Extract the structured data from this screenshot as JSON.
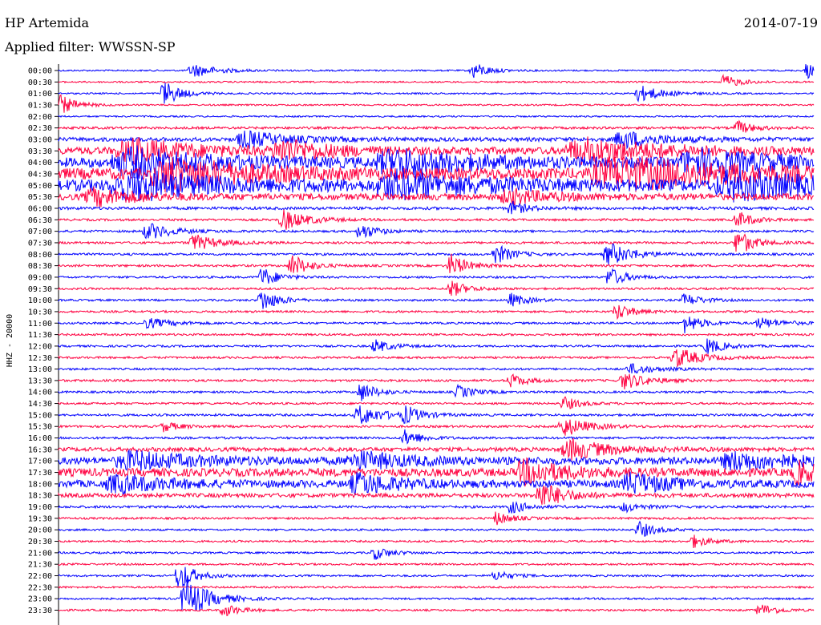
{
  "header": {
    "station": "HP Artemida",
    "filter": "Applied filter: WWSSN-SP",
    "date": "2014-07-19"
  },
  "chart_data": {
    "type": "helicorder",
    "title": "HP Artemida",
    "subtitle": "Applied filter: WWSSN-SP",
    "date": "2014-07-19",
    "ylabel": "HHZ - 20000",
    "x_minutes_per_line": 30,
    "colors": {
      "a": "#0000ff",
      "b": "#ff0040"
    },
    "rows": [
      {
        "time": "00:00",
        "color": "a",
        "amp": 1.0,
        "events": [
          [
            0.18,
            8,
            0.03
          ],
          [
            0.55,
            10,
            0.02
          ],
          [
            0.99,
            12,
            0.01
          ]
        ]
      },
      {
        "time": "00:30",
        "color": "b",
        "amp": 1.0,
        "events": [
          [
            0.88,
            9,
            0.02
          ]
        ]
      },
      {
        "time": "01:00",
        "color": "a",
        "amp": 1.0,
        "events": [
          [
            0.14,
            16,
            0.02
          ],
          [
            0.77,
            10,
            0.03
          ]
        ]
      },
      {
        "time": "01:30",
        "color": "b",
        "amp": 1.0,
        "events": [
          [
            0.0,
            14,
            0.02
          ]
        ]
      },
      {
        "time": "02:00",
        "color": "a",
        "amp": 1.0,
        "events": []
      },
      {
        "time": "02:30",
        "color": "b",
        "amp": 1.5,
        "events": [
          [
            0.9,
            8,
            0.02
          ]
        ]
      },
      {
        "time": "03:00",
        "color": "a",
        "amp": 2.5,
        "events": [
          [
            0.25,
            10,
            0.05
          ],
          [
            0.75,
            10,
            0.05
          ]
        ]
      },
      {
        "time": "03:30",
        "color": "b",
        "amp": 4.5,
        "events": [
          [
            0.1,
            14,
            0.08
          ],
          [
            0.3,
            12,
            0.06
          ],
          [
            0.7,
            14,
            0.1
          ]
        ]
      },
      {
        "time": "04:00",
        "color": "a",
        "amp": 6.0,
        "events": [
          [
            0.1,
            16,
            0.1
          ],
          [
            0.45,
            14,
            0.1
          ],
          [
            0.85,
            14,
            0.1
          ]
        ]
      },
      {
        "time": "04:30",
        "color": "b",
        "amp": 7.0,
        "events": [
          [
            0.15,
            18,
            0.1
          ],
          [
            0.75,
            18,
            0.15
          ]
        ]
      },
      {
        "time": "05:00",
        "color": "a",
        "amp": 7.0,
        "events": [
          [
            0.1,
            16,
            0.1
          ],
          [
            0.45,
            14,
            0.1
          ],
          [
            0.9,
            16,
            0.1
          ]
        ]
      },
      {
        "time": "05:30",
        "color": "b",
        "amp": 4.0,
        "events": [
          [
            0.05,
            10,
            0.05
          ],
          [
            0.6,
            8,
            0.05
          ]
        ]
      },
      {
        "time": "06:00",
        "color": "a",
        "amp": 1.8,
        "events": [
          [
            0.6,
            8,
            0.02
          ]
        ]
      },
      {
        "time": "06:30",
        "color": "b",
        "amp": 1.4,
        "events": [
          [
            0.3,
            12,
            0.03
          ],
          [
            0.9,
            10,
            0.02
          ]
        ]
      },
      {
        "time": "07:00",
        "color": "a",
        "amp": 1.4,
        "events": [
          [
            0.12,
            10,
            0.03
          ],
          [
            0.4,
            10,
            0.02
          ]
        ]
      },
      {
        "time": "07:30",
        "color": "b",
        "amp": 1.4,
        "events": [
          [
            0.18,
            10,
            0.03
          ],
          [
            0.9,
            16,
            0.02
          ]
        ]
      },
      {
        "time": "08:00",
        "color": "a",
        "amp": 1.4,
        "events": [
          [
            0.58,
            12,
            0.02
          ],
          [
            0.73,
            14,
            0.03
          ]
        ]
      },
      {
        "time": "08:30",
        "color": "b",
        "amp": 1.4,
        "events": [
          [
            0.31,
            14,
            0.02
          ],
          [
            0.52,
            14,
            0.02
          ]
        ]
      },
      {
        "time": "09:00",
        "color": "a",
        "amp": 1.3,
        "events": [
          [
            0.27,
            12,
            0.02
          ],
          [
            0.73,
            12,
            0.02
          ]
        ]
      },
      {
        "time": "09:30",
        "color": "b",
        "amp": 1.3,
        "events": [
          [
            0.52,
            10,
            0.02
          ]
        ]
      },
      {
        "time": "10:00",
        "color": "a",
        "amp": 1.3,
        "events": [
          [
            0.27,
            14,
            0.02
          ],
          [
            0.6,
            8,
            0.02
          ],
          [
            0.83,
            8,
            0.02
          ]
        ]
      },
      {
        "time": "10:30",
        "color": "b",
        "amp": 1.3,
        "events": [
          [
            0.74,
            10,
            0.02
          ]
        ]
      },
      {
        "time": "11:00",
        "color": "a",
        "amp": 1.3,
        "events": [
          [
            0.12,
            6,
            0.03
          ],
          [
            0.83,
            12,
            0.02
          ],
          [
            0.93,
            6,
            0.03
          ]
        ]
      },
      {
        "time": "11:30",
        "color": "b",
        "amp": 1.3,
        "events": []
      },
      {
        "time": "12:00",
        "color": "a",
        "amp": 1.3,
        "events": [
          [
            0.42,
            8,
            0.02
          ],
          [
            0.86,
            10,
            0.02
          ]
        ]
      },
      {
        "time": "12:30",
        "color": "b",
        "amp": 1.3,
        "events": [
          [
            0.82,
            12,
            0.03
          ]
        ]
      },
      {
        "time": "13:00",
        "color": "a",
        "amp": 1.3,
        "events": [
          [
            0.76,
            6,
            0.03
          ]
        ]
      },
      {
        "time": "13:30",
        "color": "b",
        "amp": 1.4,
        "events": [
          [
            0.6,
            8,
            0.02
          ],
          [
            0.75,
            10,
            0.03
          ]
        ]
      },
      {
        "time": "14:00",
        "color": "a",
        "amp": 1.3,
        "events": [
          [
            0.4,
            12,
            0.02
          ],
          [
            0.53,
            8,
            0.02
          ]
        ]
      },
      {
        "time": "14:30",
        "color": "b",
        "amp": 1.3,
        "events": [
          [
            0.67,
            8,
            0.02
          ]
        ]
      },
      {
        "time": "15:00",
        "color": "a",
        "amp": 1.4,
        "events": [
          [
            0.4,
            12,
            0.03
          ],
          [
            0.46,
            10,
            0.02
          ]
        ]
      },
      {
        "time": "15:30",
        "color": "b",
        "amp": 1.4,
        "events": [
          [
            0.14,
            6,
            0.02
          ],
          [
            0.67,
            12,
            0.03
          ]
        ]
      },
      {
        "time": "16:00",
        "color": "a",
        "amp": 1.4,
        "events": [
          [
            0.46,
            10,
            0.02
          ]
        ]
      },
      {
        "time": "16:30",
        "color": "b",
        "amp": 2.5,
        "events": [
          [
            0.68,
            12,
            0.05
          ]
        ]
      },
      {
        "time": "17:00",
        "color": "a",
        "amp": 4.5,
        "events": [
          [
            0.1,
            10,
            0.08
          ],
          [
            0.4,
            10,
            0.06
          ],
          [
            0.9,
            10,
            0.08
          ]
        ]
      },
      {
        "time": "17:30",
        "color": "b",
        "amp": 5.0,
        "events": [
          [
            0.62,
            14,
            0.05
          ],
          [
            0.98,
            12,
            0.03
          ]
        ]
      },
      {
        "time": "18:00",
        "color": "a",
        "amp": 4.5,
        "events": [
          [
            0.08,
            10,
            0.06
          ],
          [
            0.4,
            12,
            0.05
          ],
          [
            0.76,
            12,
            0.05
          ]
        ]
      },
      {
        "time": "18:30",
        "color": "b",
        "amp": 2.5,
        "events": [
          [
            0.64,
            16,
            0.03
          ]
        ]
      },
      {
        "time": "19:00",
        "color": "a",
        "amp": 1.5,
        "events": [
          [
            0.6,
            8,
            0.02
          ],
          [
            0.75,
            6,
            0.02
          ]
        ]
      },
      {
        "time": "19:30",
        "color": "b",
        "amp": 1.3,
        "events": [
          [
            0.58,
            8,
            0.02
          ]
        ]
      },
      {
        "time": "20:00",
        "color": "a",
        "amp": 1.2,
        "events": [
          [
            0.77,
            10,
            0.02
          ]
        ]
      },
      {
        "time": "20:30",
        "color": "b",
        "amp": 1.2,
        "events": [
          [
            0.84,
            8,
            0.02
          ]
        ]
      },
      {
        "time": "21:00",
        "color": "a",
        "amp": 1.2,
        "events": [
          [
            0.42,
            8,
            0.02
          ]
        ]
      },
      {
        "time": "21:30",
        "color": "b",
        "amp": 1.2,
        "events": []
      },
      {
        "time": "22:00",
        "color": "a",
        "amp": 1.2,
        "events": [
          [
            0.16,
            18,
            0.02
          ],
          [
            0.58,
            6,
            0.02
          ]
        ]
      },
      {
        "time": "22:30",
        "color": "b",
        "amp": 1.2,
        "events": []
      },
      {
        "time": "23:00",
        "color": "a",
        "amp": 1.2,
        "events": [
          [
            0.17,
            24,
            0.03
          ]
        ]
      },
      {
        "time": "23:30",
        "color": "b",
        "amp": 1.2,
        "events": [
          [
            0.22,
            8,
            0.02
          ],
          [
            0.93,
            8,
            0.02
          ]
        ]
      }
    ]
  }
}
